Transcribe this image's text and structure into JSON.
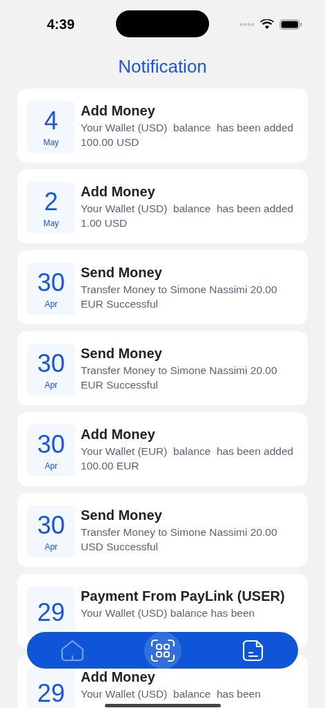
{
  "status_bar": {
    "time": "4:39"
  },
  "header": {
    "title": "Notification"
  },
  "notifications": [
    {
      "day": "4",
      "month": "May",
      "title": "Add Money",
      "body": "Your Wallet (USD)  balance  has been added 100.00 USD"
    },
    {
      "day": "2",
      "month": "May",
      "title": "Add Money",
      "body": "Your Wallet (USD)  balance  has been added 1.00 USD"
    },
    {
      "day": "30",
      "month": "Apr",
      "title": "Send Money",
      "body": "Transfer Money to Simone Nassimi 20.00 EUR Successful"
    },
    {
      "day": "30",
      "month": "Apr",
      "title": "Send Money",
      "body": "Transfer Money to Simone Nassimi 20.00 EUR Successful"
    },
    {
      "day": "30",
      "month": "Apr",
      "title": "Add Money",
      "body": "Your Wallet (EUR)  balance  has been added 100.00 EUR"
    },
    {
      "day": "30",
      "month": "Apr",
      "title": "Send Money",
      "body": "Transfer Money to Simone Nassimi 20.00 USD Successful"
    },
    {
      "day": "29",
      "title": "Payment From PayLink (USER)",
      "body": "Your Wallet (USD) balance has been"
    },
    {
      "day": "29",
      "title": "Add Money",
      "body": "Your Wallet (USD)  balance  has been"
    }
  ],
  "tab_bar": [
    {
      "kind": "home",
      "selected": false,
      "dimmed": true
    },
    {
      "kind": "scan",
      "selected": true,
      "dimmed": false
    },
    {
      "kind": "document",
      "selected": false,
      "dimmed": false
    }
  ]
}
